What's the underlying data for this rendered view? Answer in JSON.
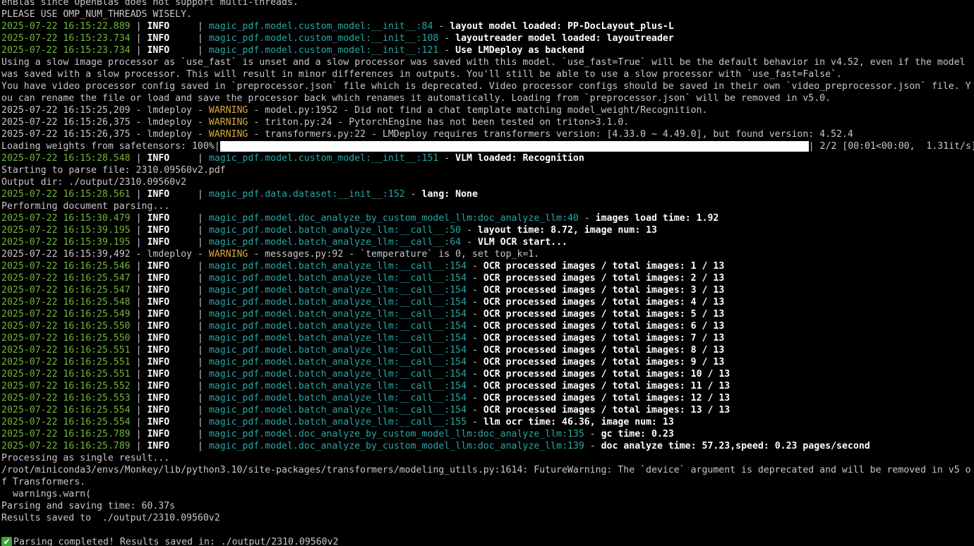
{
  "terminal": {
    "lines": [
      {
        "type": "plain",
        "text": "enBlas since OpenBlas does not support multi-threads."
      },
      {
        "type": "plain",
        "text": "PLEASE USE OMP_NUM_THREADS WISELY."
      },
      {
        "type": "log",
        "ts": "2025-07-22 16:15:22.889",
        "level": "INFO",
        "src": "magic_pdf.model.custom_model:__init__:84",
        "msg": "layout model loaded: PP-DocLayout_plus-L"
      },
      {
        "type": "log",
        "ts": "2025-07-22 16:15:23.734",
        "level": "INFO",
        "src": "magic_pdf.model.custom_model:__init__:108",
        "msg": "layoutreader model loaded: layoutreader"
      },
      {
        "type": "log",
        "ts": "2025-07-22 16:15:23.734",
        "level": "INFO",
        "src": "magic_pdf.model.custom_model:__init__:121",
        "msg": "Use LMDeploy as backend"
      },
      {
        "type": "plain",
        "text": "Using a slow image processor as `use_fast` is unset and a slow processor was saved with this model. `use_fast=True` will be the default behavior in v4.52, even if the model"
      },
      {
        "type": "plain",
        "text": "was saved with a slow processor. This will result in minor differences in outputs. You'll still be able to use a slow processor with `use_fast=False`."
      },
      {
        "type": "plain",
        "text": "You have video processor config saved in `preprocessor.json` file which is deprecated. Video processor configs should be saved in their own `video_preprocessor.json` file. Y"
      },
      {
        "type": "plain",
        "text": "ou can rename the file or load and save the processor back which renames it automatically. Loading from `preprocessor.json` will be removed in v5.0."
      },
      {
        "type": "warn",
        "pre": "2025-07-22 16:15:25,209 - lmdeploy - ",
        "level": "WARNING",
        "post": " - model.py:1952 - Did not find a chat template matching model_weight/Recognition."
      },
      {
        "type": "warn",
        "pre": "2025-07-22 16:15:26,375 - lmdeploy - ",
        "level": "WARNING",
        "post": " - triton.py:24 - PytorchEngine has not been tested on triton>3.1.0."
      },
      {
        "type": "warn",
        "pre": "2025-07-22 16:15:26,375 - lmdeploy - ",
        "level": "WARNING",
        "post": " - transformers.py:22 - LMDeploy requires transformers version: [4.33.0 ~ 4.49.0], but found version: 4.52.4"
      },
      {
        "type": "progress",
        "label": "Loading weights from safetensors: 100%|",
        "progress": 1.0,
        "tail": "| 2/2 [00:01<00:00,  1.31it/s]"
      },
      {
        "type": "log",
        "ts": "2025-07-22 16:15:28.548",
        "level": "INFO",
        "src": "magic_pdf.model.custom_model:__init__:151",
        "msg": "VLM loaded: Recognition"
      },
      {
        "type": "plain",
        "text": "Starting to parse file: 2310.09560v2.pdf"
      },
      {
        "type": "plain",
        "text": "Output dir: ./output/2310.09560v2"
      },
      {
        "type": "log",
        "ts": "2025-07-22 16:15:28.561",
        "level": "INFO",
        "src": "magic_pdf.data.dataset:__init__:152",
        "msg": "lang: None"
      },
      {
        "type": "plain",
        "text": "Performing document parsing..."
      },
      {
        "type": "log",
        "ts": "2025-07-22 16:15:30.479",
        "level": "INFO",
        "src": "magic_pdf.model.doc_analyze_by_custom_model_llm:doc_analyze_llm:40",
        "msg": "images load time: 1.92"
      },
      {
        "type": "log",
        "ts": "2025-07-22 16:15:39.195",
        "level": "INFO",
        "src": "magic_pdf.model.batch_analyze_llm:__call__:50",
        "msg": "layout time: 8.72, image num: 13"
      },
      {
        "type": "log",
        "ts": "2025-07-22 16:15:39.195",
        "level": "INFO",
        "src": "magic_pdf.model.batch_analyze_llm:__call__:64",
        "msg": "VLM OCR start..."
      },
      {
        "type": "warn",
        "pre": "2025-07-22 16:15:39,492 - lmdeploy - ",
        "level": "WARNING",
        "post": " - messages.py:92 - `temperature` is 0, set top_k=1."
      },
      {
        "type": "log",
        "ts": "2025-07-22 16:16:25.546",
        "level": "INFO",
        "src": "magic_pdf.model.batch_analyze_llm:__call__:154",
        "msg": "OCR processed images / total images: 1 / 13"
      },
      {
        "type": "log",
        "ts": "2025-07-22 16:16:25.547",
        "level": "INFO",
        "src": "magic_pdf.model.batch_analyze_llm:__call__:154",
        "msg": "OCR processed images / total images: 2 / 13"
      },
      {
        "type": "log",
        "ts": "2025-07-22 16:16:25.547",
        "level": "INFO",
        "src": "magic_pdf.model.batch_analyze_llm:__call__:154",
        "msg": "OCR processed images / total images: 3 / 13"
      },
      {
        "type": "log",
        "ts": "2025-07-22 16:16:25.548",
        "level": "INFO",
        "src": "magic_pdf.model.batch_analyze_llm:__call__:154",
        "msg": "OCR processed images / total images: 4 / 13"
      },
      {
        "type": "log",
        "ts": "2025-07-22 16:16:25.549",
        "level": "INFO",
        "src": "magic_pdf.model.batch_analyze_llm:__call__:154",
        "msg": "OCR processed images / total images: 5 / 13"
      },
      {
        "type": "log",
        "ts": "2025-07-22 16:16:25.550",
        "level": "INFO",
        "src": "magic_pdf.model.batch_analyze_llm:__call__:154",
        "msg": "OCR processed images / total images: 6 / 13"
      },
      {
        "type": "log",
        "ts": "2025-07-22 16:16:25.550",
        "level": "INFO",
        "src": "magic_pdf.model.batch_analyze_llm:__call__:154",
        "msg": "OCR processed images / total images: 7 / 13"
      },
      {
        "type": "log",
        "ts": "2025-07-22 16:16:25.551",
        "level": "INFO",
        "src": "magic_pdf.model.batch_analyze_llm:__call__:154",
        "msg": "OCR processed images / total images: 8 / 13"
      },
      {
        "type": "log",
        "ts": "2025-07-22 16:16:25.551",
        "level": "INFO",
        "src": "magic_pdf.model.batch_analyze_llm:__call__:154",
        "msg": "OCR processed images / total images: 9 / 13"
      },
      {
        "type": "log",
        "ts": "2025-07-22 16:16:25.551",
        "level": "INFO",
        "src": "magic_pdf.model.batch_analyze_llm:__call__:154",
        "msg": "OCR processed images / total images: 10 / 13"
      },
      {
        "type": "log",
        "ts": "2025-07-22 16:16:25.552",
        "level": "INFO",
        "src": "magic_pdf.model.batch_analyze_llm:__call__:154",
        "msg": "OCR processed images / total images: 11 / 13"
      },
      {
        "type": "log",
        "ts": "2025-07-22 16:16:25.553",
        "level": "INFO",
        "src": "magic_pdf.model.batch_analyze_llm:__call__:154",
        "msg": "OCR processed images / total images: 12 / 13"
      },
      {
        "type": "log",
        "ts": "2025-07-22 16:16:25.554",
        "level": "INFO",
        "src": "magic_pdf.model.batch_analyze_llm:__call__:154",
        "msg": "OCR processed images / total images: 13 / 13"
      },
      {
        "type": "log",
        "ts": "2025-07-22 16:16:25.554",
        "level": "INFO",
        "src": "magic_pdf.model.batch_analyze_llm:__call__:155",
        "msg": "llm ocr time: 46.36, image num: 13"
      },
      {
        "type": "log",
        "ts": "2025-07-22 16:16:25.789",
        "level": "INFO",
        "src": "magic_pdf.model.doc_analyze_by_custom_model_llm:doc_analyze_llm:135",
        "msg": "gc time: 0.23"
      },
      {
        "type": "log",
        "ts": "2025-07-22 16:16:25.789",
        "level": "INFO",
        "src": "magic_pdf.model.doc_analyze_by_custom_model_llm:doc_analyze_llm:139",
        "msg": "doc analyze time: 57.23,speed: 0.23 pages/second"
      },
      {
        "type": "plain",
        "text": "Processing as single result..."
      },
      {
        "type": "plain",
        "text": "/root/miniconda3/envs/Monkey/lib/python3.10/site-packages/transformers/modeling_utils.py:1614: FutureWarning: The `device` argument is deprecated and will be removed in v5 o"
      },
      {
        "type": "plain",
        "text": "f Transformers."
      },
      {
        "type": "plain",
        "text": "  warnings.warn("
      },
      {
        "type": "plain",
        "text": "Parsing and saving time: 60.37s"
      },
      {
        "type": "plain",
        "text": "Results saved to  ./output/2310.09560v2"
      },
      {
        "type": "plain",
        "text": ""
      },
      {
        "type": "done",
        "icon": "check-mark-icon",
        "text": "Parsing completed! Results saved in: ./output/2310.09560v2"
      }
    ]
  },
  "colors": {
    "background": "#000000",
    "timestamp": "#6fb83a",
    "source": "#2aa6a6",
    "warning": "#d8a838",
    "text": "#c8c8c8",
    "bold_text": "#ffffff",
    "check_icon": "#3ca23c"
  }
}
